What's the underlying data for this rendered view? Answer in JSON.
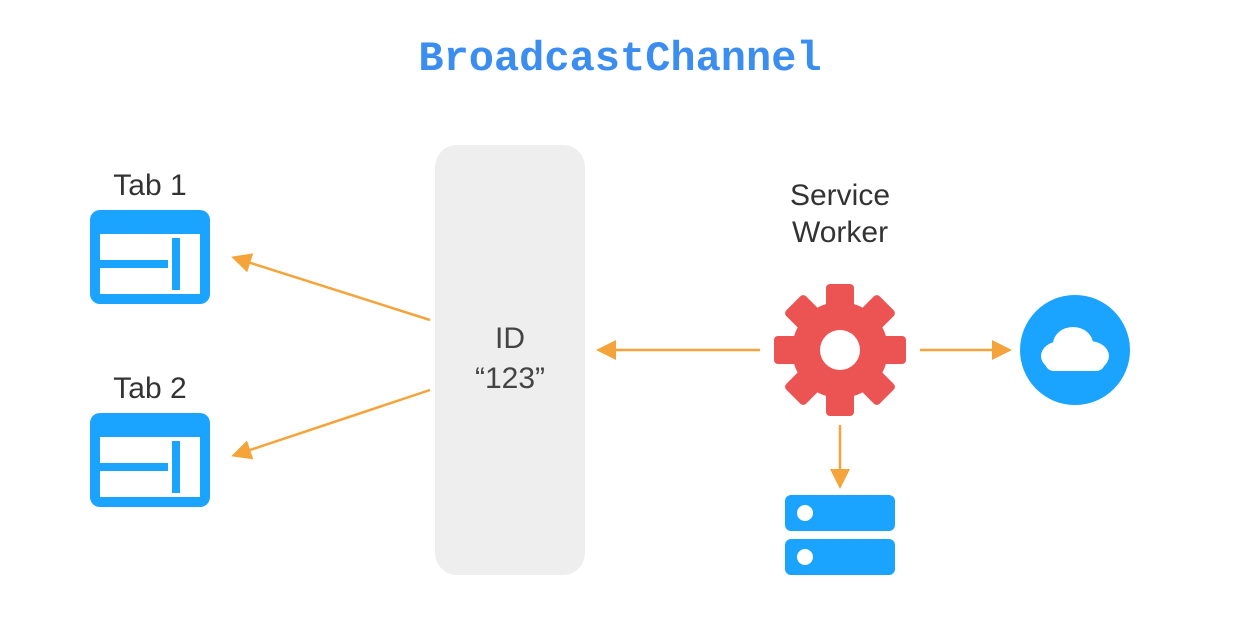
{
  "title": "BroadcastChannel",
  "tabs": {
    "tab1": "Tab 1",
    "tab2": "Tab 2"
  },
  "channel": {
    "id_label": "ID",
    "id_value": "“123”"
  },
  "service_worker": {
    "label_line1": "Service",
    "label_line2": "Worker"
  },
  "icons": {
    "window": "window-icon",
    "gear": "gear-icon",
    "cloud": "cloud-icon",
    "storage": "storage-icon"
  },
  "colors": {
    "blue": "#1aa3ff",
    "cloudBlue": "#1aa3ff",
    "red": "#ec5353",
    "arrow": "#f4a43a",
    "channelBg": "#eeeeee",
    "titleBlue": "#3b8ef0"
  }
}
